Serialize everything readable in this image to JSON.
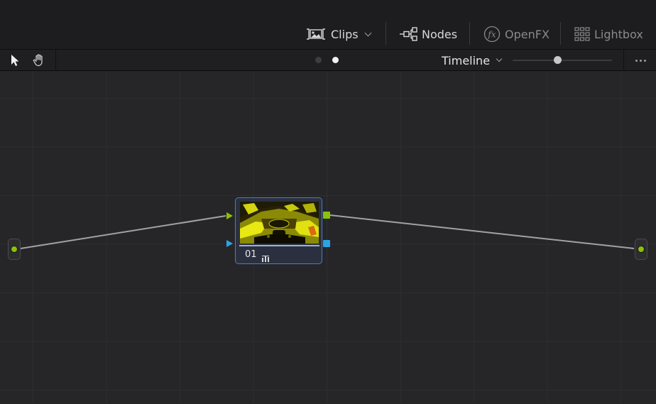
{
  "header": {
    "clips_label": "Clips",
    "nodes_label": "Nodes",
    "openfx_label": "OpenFX",
    "lightbox_label": "Lightbox"
  },
  "toolbar": {
    "pointer_tool": "pointer-icon",
    "hand_tool": "hand-icon",
    "pages": [
      {
        "active": false
      },
      {
        "active": true
      }
    ],
    "timeline_label": "Timeline",
    "zoom_level": 0.45
  },
  "graph": {
    "nodes": [
      {
        "label": "01",
        "icon": "bars-icon"
      }
    ],
    "colors": {
      "rgb_port": "#8ac10a",
      "alpha_port": "#2ea3e6",
      "node_border": "#4a7ec0",
      "wire": "#a2a2a6"
    }
  }
}
